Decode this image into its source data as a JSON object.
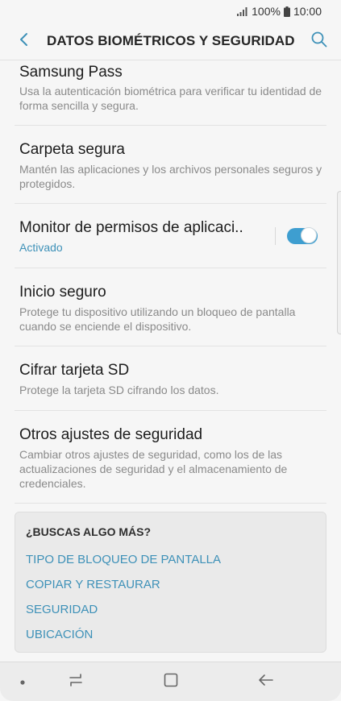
{
  "status_bar": {
    "battery": "100%",
    "time": "10:00",
    "icons": [
      "signal-icon",
      "battery-icon"
    ]
  },
  "header": {
    "title": "DATOS BIOMÉTRICOS Y SEGURIDAD",
    "back_icon": "chevron-left-icon",
    "search_icon": "search-icon"
  },
  "settings": [
    {
      "title": "Samsung Pass",
      "description": "Usa la autenticación biométrica para verificar tu identidad de forma sencilla y segura."
    },
    {
      "title": "Carpeta segura",
      "description": "Mantén las aplicaciones y los archivos personales seguros y protegidos."
    },
    {
      "title": "Monitor de permisos de aplicaci..",
      "status": "Activado",
      "toggle_on": true
    },
    {
      "title": "Inicio seguro",
      "description": "Protege tu dispositivo utilizando un bloqueo de pantalla cuando se enciende el dispositivo."
    },
    {
      "title": "Cifrar tarjeta SD",
      "description": "Protege la tarjeta SD cifrando los datos."
    },
    {
      "title": "Otros ajustes de seguridad",
      "description": "Cambiar otros ajustes de seguridad, como los de las actualizaciones de seguridad y el almacenamiento de credenciales."
    }
  ],
  "suggestions": {
    "title": "¿BUSCAS ALGO MÁS?",
    "links": [
      "TIPO DE BLOQUEO DE PANTALLA",
      "COPIAR Y RESTAURAR",
      "SEGURIDAD",
      "UBICACIÓN"
    ]
  },
  "nav_bar": {
    "icons": [
      "dot-icon",
      "recent-apps-icon",
      "home-icon",
      "back-arrow-icon"
    ]
  },
  "colors": {
    "accent": "#3e91b8",
    "toggle_on": "#3e9ed0",
    "background": "#f6f6f6"
  }
}
